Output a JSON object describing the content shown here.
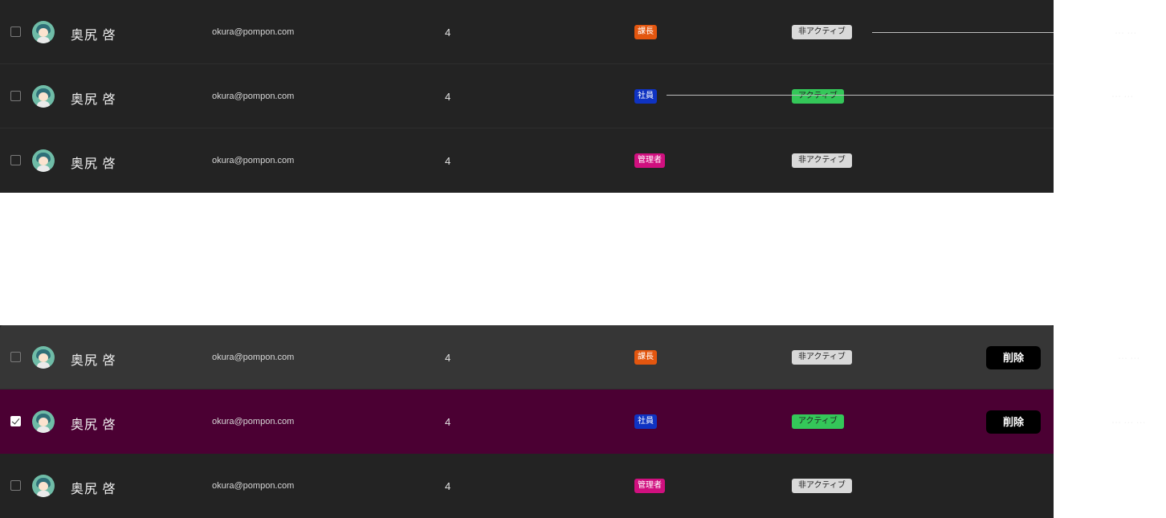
{
  "users": [
    {
      "name": "奥尻 啓",
      "email": "okura@pompon.com",
      "count": "4",
      "role": "課長",
      "role_color": "#e3560f",
      "status": "非アクティブ",
      "status_color": "#d9d9d9",
      "delete_label": "",
      "selected": false
    },
    {
      "name": "奥尻 啓",
      "email": "okura@pompon.com",
      "count": "4",
      "role": "社員",
      "role_color": "#0f33c2",
      "status": "アクティブ",
      "status_color": "#34c759",
      "delete_label": "",
      "selected": false
    },
    {
      "name": "奥尻 啓",
      "email": "okura@pompon.com",
      "count": "4",
      "role": "管理者",
      "role_color": "#d0107f",
      "status": "非アクティブ",
      "status_color": "#d9d9d9",
      "delete_label": "",
      "selected": false
    },
    {
      "name": "奥尻 啓",
      "email": "okura@pompon.com",
      "count": "4",
      "role": "課長",
      "role_color": "#e3560f",
      "status": "非アクティブ",
      "status_color": "#d9d9d9",
      "delete_label": "削除",
      "selected": false
    },
    {
      "name": "奥尻 啓",
      "email": "okura@pompon.com",
      "count": "4",
      "role": "社員",
      "role_color": "#0f33c2",
      "status": "アクティブ",
      "status_color": "#34c759",
      "delete_label": "削除",
      "selected": true
    },
    {
      "name": "奥尻 啓",
      "email": "okura@pompon.com",
      "count": "4",
      "role": "管理者",
      "role_color": "#d0107f",
      "status": "非アクティブ",
      "status_color": "#d9d9d9",
      "delete_label": "",
      "selected": false
    }
  ],
  "colors": {
    "row_background": "#232323",
    "row_hover": "#363636",
    "row_selected": "#4b0033",
    "page_background": "#ffffff"
  },
  "icons": {
    "avatar": "user-avatar-icon",
    "checkbox": "checkbox-icon"
  }
}
